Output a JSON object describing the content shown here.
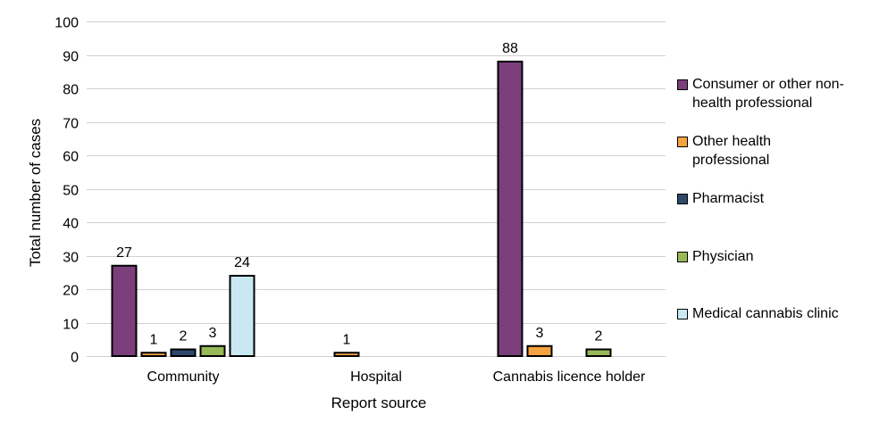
{
  "chart_data": {
    "type": "bar",
    "title": "",
    "xlabel": "Report source",
    "ylabel": "Total number of cases",
    "ylim": [
      0,
      100
    ],
    "yticks": [
      0,
      10,
      20,
      30,
      40,
      50,
      60,
      70,
      80,
      90,
      100
    ],
    "grid": true,
    "legend_position": "right",
    "categories": [
      "Community",
      "Hospital",
      "Cannabis licence holder"
    ],
    "series": [
      {
        "name": "Consumer or other non-health professional",
        "color": "#7b3f7c",
        "values": [
          27,
          null,
          88
        ]
      },
      {
        "name": "Other health professional",
        "color": "#f5a341",
        "values": [
          1,
          1,
          3
        ]
      },
      {
        "name": "Pharmacist",
        "color": "#2e4a6b",
        "values": [
          2,
          null,
          null
        ]
      },
      {
        "name": "Physician",
        "color": "#97b957",
        "values": [
          3,
          null,
          2
        ]
      },
      {
        "name": "Medical cannabis clinic",
        "color": "#c9e8f2",
        "values": [
          24,
          null,
          null
        ]
      }
    ]
  },
  "legend": {
    "items": [
      {
        "lines": [
          "Consumer or other non-",
          "health professional"
        ]
      },
      {
        "lines": [
          "Other health",
          "professional"
        ]
      },
      {
        "lines": [
          "Pharmacist"
        ]
      },
      {
        "lines": [
          "Physician"
        ]
      },
      {
        "lines": [
          "Medical cannabis clinic"
        ]
      }
    ]
  }
}
